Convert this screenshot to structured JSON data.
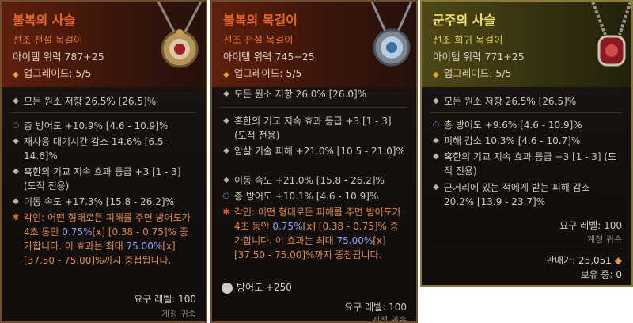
{
  "cards": [
    {
      "title": "불복의 사슬",
      "rarity": "선조 전설 목걸이",
      "power": "아이템 위력 787+25",
      "upgrade": "업그레이드: 5/5",
      "base": "모든 원소 저항 26.5% [26.5]%",
      "affixes": [
        "총 방어도 +10.9% [4.6 - 10.9]%",
        "재사용 대기시간 감소 14.6% [6.5 - 14.6]%",
        "혹한의 기교 지속 효과 등급 +3 [1 - 3] (도적 전용)",
        "이동 속도 +17.3% [15.8 - 26.2]%"
      ],
      "aspect": {
        "a": "각인: 어떤 형태로든 피해를 주면 방어도가 4초 동안 ",
        "v1": "0.75%",
        "b": "[x] [0.38 - 0.75]% 증가합니다. 이 효과는 최대 ",
        "v2": "75.00%",
        "c": "[x] [37.50 - 75.00]%까지 중첩됩니다."
      },
      "req": "요구 레벨: 100",
      "account": "계정 귀속"
    },
    {
      "title": "불복의 목걸이",
      "rarity": "선조 전설 목걸이",
      "power": "아이템 위력 745+25",
      "upgrade": "업그레이드: 5/5",
      "base": "모든 원소 저항 26.0% [26.0]%",
      "affixes": [
        "혹한의 기교 지속 효과 등급 +3 [1 - 3] (도적 전용)",
        "암살 기술 피해 +21.0% [10.5 - 21.0]%",
        "이동 속도 +21.0% [15.8 - 26.2]%",
        "총 방어도 +10.1% [4.6 - 10.9]%"
      ],
      "aspect": {
        "a": "각인: 어떤 형태로든 피해를 주면 방어도가 4초 동안 ",
        "v1": "0.75%",
        "b": "[x] [0.38 - 0.75]% 증가합니다. 이 효과는 최대 ",
        "v2": "75.00%",
        "c": "[x] [37.50 - 75.00]%까지 중첩됩니다."
      },
      "armor": "방어도 +250",
      "req": "요구 레벨: 100",
      "account": "계정 귀속"
    },
    {
      "title": "군주의 사슬",
      "rarity": "선조 희귀 목걸이",
      "power": "아이템 위력 771+25",
      "upgrade": "업그레이드: 5/5",
      "base": "모든 원소 저항 26.5% [26.5]%",
      "affixes": [
        "총 방어도 +9.6% [4.6 - 10.9]%",
        "피해 감소 10.3% [4.6 - 10.7]%",
        "혹한의 기교 지속 효과 등급 +3 [1 - 3] (도적 전용)",
        "근거리에 있는 적에게 받는 피해 감소 20.2% [13.9 - 23.7]%"
      ],
      "req": "요구 레벨: 100",
      "account": "계정 귀속",
      "price_label": "판매가: 25,051",
      "owned": "보유 중: 0"
    }
  ],
  "colors": {
    "legendary": "#e7662a",
    "rare": "#efe06a",
    "aspect": "#e08a4a",
    "value": "#8aa3f0"
  }
}
